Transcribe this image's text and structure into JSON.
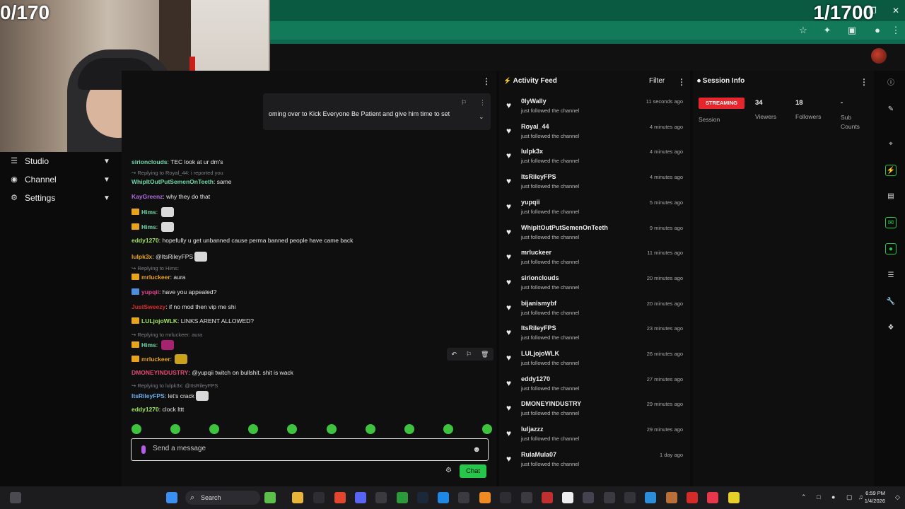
{
  "overlay": {
    "left_counter": "0/170",
    "right_counter": "1/1700"
  },
  "nav": {
    "items": [
      {
        "label": "Studio",
        "icon": "sliders-icon"
      },
      {
        "label": "Channel",
        "icon": "broadcast-icon"
      },
      {
        "label": "Settings",
        "icon": "gear-icon"
      }
    ]
  },
  "chat": {
    "pinned_text": "oming over to Kick Everyone Be Patient and give him time to set",
    "messages": [
      {
        "user": "sirionclouds",
        "color": "#6fd6a8",
        "text": "TEC look at ur dm's"
      },
      {
        "reply": "Replying to Royal_44: i reported you"
      },
      {
        "user": "WhipItOutPutSemenOnTeeth",
        "color": "#6fd6a8",
        "text": "same"
      },
      {
        "user": "KayGreenz",
        "color": "#b06de0",
        "text": "why they do that"
      },
      {
        "user": "Hims",
        "color": "#6fd6a8",
        "text": ""
      },
      {
        "user": "Hims",
        "color": "#6fd6a8",
        "text": ""
      },
      {
        "user": "eddy1270",
        "color": "#a0e05a",
        "text": "hopefully u get unbanned cause perma banned people have came back"
      },
      {
        "user": "lulpk3x",
        "color": "#e8a31c",
        "text": "@ItsRileyFPS"
      },
      {
        "reply": "Replying to Hims:"
      },
      {
        "user": "mrluckeer",
        "color": "#e8a31c",
        "text": "aura"
      },
      {
        "user": "yupqii",
        "color": "#e0408a",
        "text": "have you appealed?"
      },
      {
        "user": "JustSweezy",
        "color": "#e02a2a",
        "text": "if no mod then vip me shi"
      },
      {
        "user": "LULjojoWLK",
        "color": "#a0e05a",
        "text": "LINKS ARENT ALLOWED?"
      },
      {
        "reply": "Replying to mrluckeer: aura"
      },
      {
        "user": "Hims",
        "color": "#6fd6a8",
        "text": ""
      },
      {
        "user": "mrluckeer",
        "color": "#e8a31c",
        "text": ""
      },
      {
        "user": "DMONEYINDUSTRY",
        "color": "#e04a70",
        "text": "@yupqii twitch on bullshit. shit is wack"
      },
      {
        "reply": "Replying to lulpk3x: @ItsRileyFPS"
      },
      {
        "user": "ItsRileyFPS",
        "color": "#6ab0f0",
        "text": "let's crack"
      },
      {
        "user": "eddy1270",
        "color": "#a0e05a",
        "text": "clock lttt"
      }
    ],
    "input_placeholder": "Send a message",
    "send_label": "Chat"
  },
  "activity_feed": {
    "title": "Activity Feed",
    "filter_label": "Filter",
    "items": [
      {
        "user": "0lyWally",
        "action": "just followed the channel",
        "time": "11 seconds ago"
      },
      {
        "user": "Royal_44",
        "action": "just followed the channel",
        "time": "4 minutes ago"
      },
      {
        "user": "lulpk3x",
        "action": "just followed the channel",
        "time": "4 minutes ago"
      },
      {
        "user": "ItsRileyFPS",
        "action": "just followed the channel",
        "time": "4 minutes ago"
      },
      {
        "user": "yupqii",
        "action": "just followed the channel",
        "time": "5 minutes ago"
      },
      {
        "user": "WhipItOutPutSemenOnTeeth",
        "action": "just followed the channel",
        "time": "9 minutes ago"
      },
      {
        "user": "mrluckeer",
        "action": "just followed the channel",
        "time": "11 minutes ago"
      },
      {
        "user": "sirionclouds",
        "action": "just followed the channel",
        "time": "20 minutes ago"
      },
      {
        "user": "bijanismybf",
        "action": "just followed the channel",
        "time": "20 minutes ago"
      },
      {
        "user": "ItsRileyFPS",
        "action": "just followed the channel",
        "time": "23 minutes ago"
      },
      {
        "user": "LULjojoWLK",
        "action": "just followed the channel",
        "time": "26 minutes ago"
      },
      {
        "user": "eddy1270",
        "action": "just followed the channel",
        "time": "27 minutes ago"
      },
      {
        "user": "DMONEYINDUSTRY",
        "action": "just followed the channel",
        "time": "29 minutes ago"
      },
      {
        "user": "luljazzz",
        "action": "just followed the channel",
        "time": "29 minutes ago"
      },
      {
        "user": "RulaMula07",
        "action": "just followed the channel",
        "time": "1 day ago"
      }
    ]
  },
  "session_info": {
    "title": "Session Info",
    "status": "STREAMING",
    "session_label": "Session",
    "viewers_value": "34",
    "viewers_label": "Viewers",
    "followers_value": "18",
    "followers_label": "Followers",
    "subs_value": "-",
    "subs_label": "Sub Counts"
  },
  "taskbar": {
    "search_label": "Search",
    "time": "6:59 PM",
    "date": "1/4/2026"
  },
  "colors": {
    "accent_green": "#25c64a",
    "streaming_red": "#e5262c",
    "browser_green": "#0e6a4e"
  }
}
